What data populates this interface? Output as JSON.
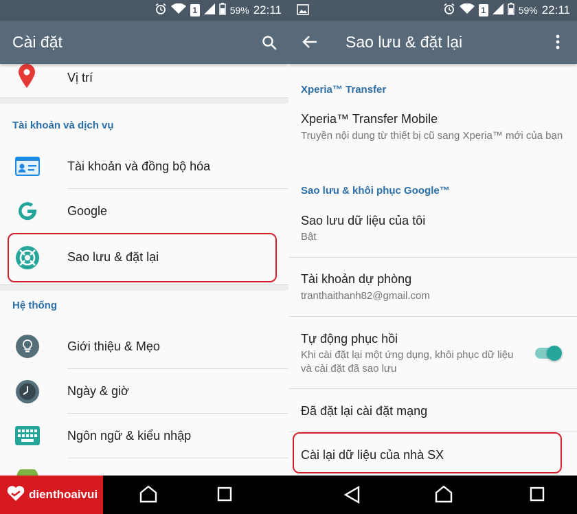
{
  "status": {
    "battery": "59%",
    "time": "22:11",
    "sim": "1"
  },
  "left": {
    "title": "Cài đặt",
    "location": "Vị trí",
    "section_accounts": "Tài khoản và dịch vụ",
    "accounts_sync": "Tài khoản và đồng bộ hóa",
    "google": "Google",
    "backup_reset": "Sao lưu & đặt lại",
    "section_system": "Hệ thống",
    "tips": "Giới thiệu & Mẹo",
    "date_time": "Ngày & giờ",
    "language_input": "Ngôn ngữ & kiểu nhập"
  },
  "right": {
    "title": "Sao lưu & đặt lại",
    "section_xperia": "Xperia™ Transfer",
    "xperia_mobile": "Xperia™ Transfer Mobile",
    "xperia_mobile_sub": "Truyền nội dung từ thiết bị cũ sang Xperia™ mới của bạn",
    "section_google": "Sao lưu & khôi phục Google™",
    "backup_data": "Sao lưu dữ liệu của tôi",
    "backup_data_sub": "Bật",
    "backup_account": "Tài khoản dự phòng",
    "backup_account_sub": "tranthaithanh82@gmail.com",
    "auto_restore": "Tự động phục hồi",
    "auto_restore_sub": "Khi cài đặt lại một ứng dụng, khôi phục dữ liệu và cài đặt đã sao lưu",
    "auto_restore_on": true,
    "network_reset": "Đã đặt lại cài đặt mạng",
    "factory_reset": "Cài lại dữ liệu của nhà SX"
  },
  "brand": {
    "name": "dienthoaivui"
  },
  "colors": {
    "appbar": "#58697a",
    "statusbar": "#4a5765",
    "section": "#2b6ea8",
    "highlight": "#d21f2b",
    "toggle": "#26a69a",
    "brand": "#d71920"
  }
}
